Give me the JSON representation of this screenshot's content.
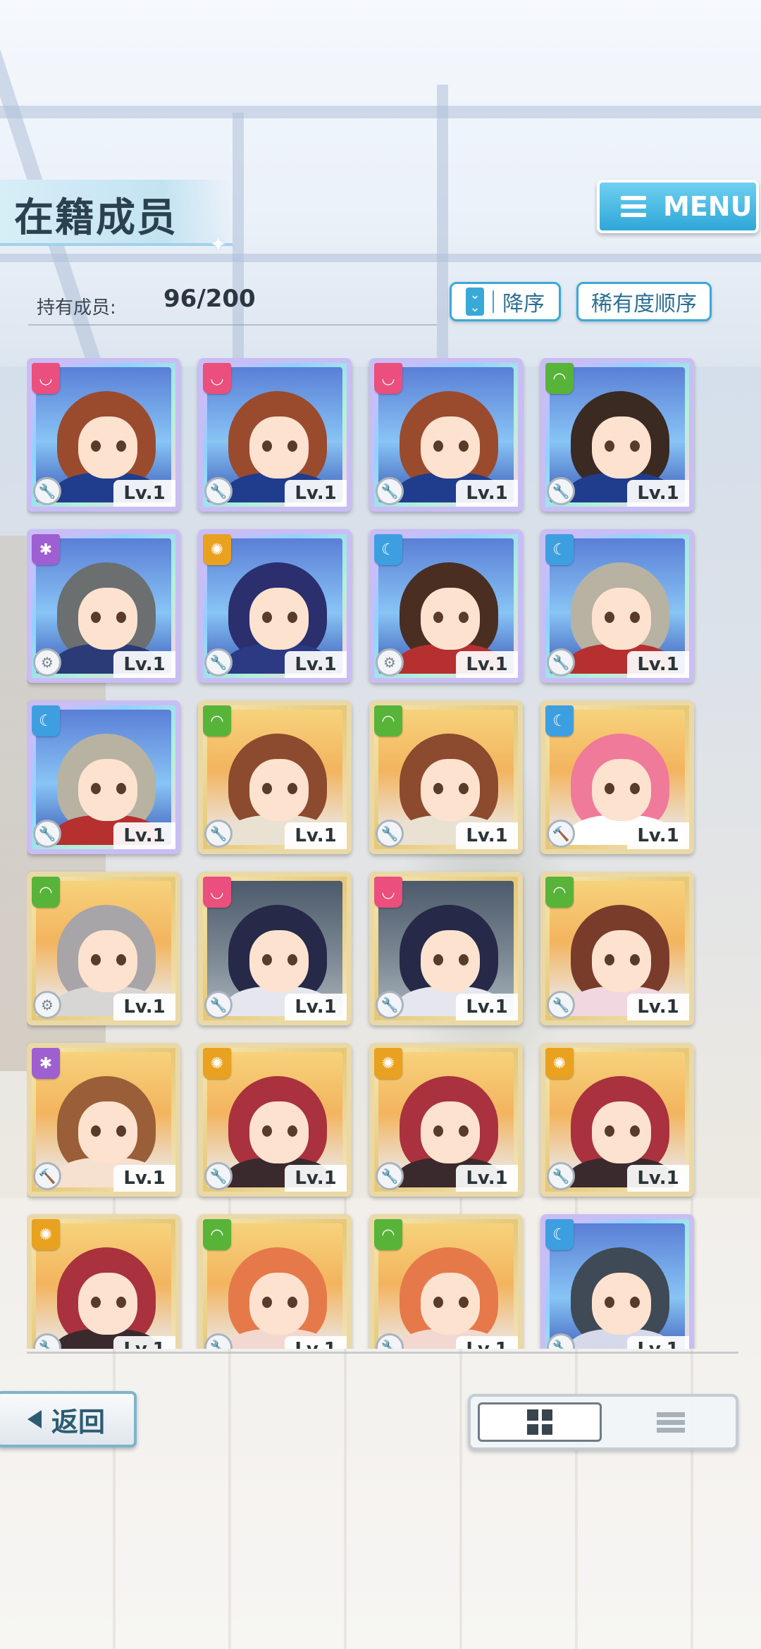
{
  "header": {
    "title": "在籍成员",
    "menu_label": "MENU"
  },
  "owned": {
    "label": "持有成员:",
    "value": "96/200"
  },
  "sort": {
    "order_label": "降序",
    "rarity_label": "稀有度顺序"
  },
  "level_text": "Lv.1",
  "cards": [
    {
      "frame": "ssr",
      "attr": "red",
      "hair": "#9a4b2e",
      "outfit": "#1f3d8c",
      "role": "wrench-icon",
      "art": "ssr"
    },
    {
      "frame": "ssr",
      "attr": "red",
      "hair": "#9a4b2e",
      "outfit": "#1f3d8c",
      "role": "wrench-icon",
      "art": "ssr"
    },
    {
      "frame": "ssr",
      "attr": "red",
      "hair": "#9a4b2e",
      "outfit": "#1f3d8c",
      "role": "wrench-icon",
      "art": "ssr"
    },
    {
      "frame": "ssr",
      "attr": "green",
      "hair": "#3a2a22",
      "outfit": "#1f3d8c",
      "role": "wrench-icon",
      "art": "ssr"
    },
    {
      "frame": "ssr",
      "attr": "purple",
      "hair": "#6b6f70",
      "outfit": "#2a3b78",
      "role": "gear-icon",
      "art": "ssr"
    },
    {
      "frame": "ssr",
      "attr": "orange",
      "hair": "#2b2f6e",
      "outfit": "#2b3a82",
      "role": "wrench-icon",
      "art": "ssr"
    },
    {
      "frame": "ssr",
      "attr": "blue",
      "hair": "#4a2e22",
      "outfit": "#b5302f",
      "role": "gear-icon",
      "art": "ssr"
    },
    {
      "frame": "ssr",
      "attr": "blue",
      "hair": "#b7b2a2",
      "outfit": "#b5302f",
      "role": "wrench-icon",
      "art": "ssr"
    },
    {
      "frame": "ssr",
      "attr": "blue",
      "hair": "#b7b2a2",
      "outfit": "#b5302f",
      "role": "wrench-icon",
      "art": "ssr"
    },
    {
      "frame": "sr",
      "attr": "green",
      "hair": "#8c4a2e",
      "outfit": "#e9e2d2",
      "role": "wrench-icon",
      "art": "sr"
    },
    {
      "frame": "sr",
      "attr": "green",
      "hair": "#8c4a2e",
      "outfit": "#e9e2d2",
      "role": "wrench-icon",
      "art": "sr"
    },
    {
      "frame": "sr",
      "attr": "blue",
      "hair": "#f07a9a",
      "outfit": "#ffffff",
      "role": "hammer-icon",
      "art": "sr"
    },
    {
      "frame": "sr",
      "attr": "green",
      "hair": "#a8a5a8",
      "outfit": "#d8d6d4",
      "role": "gear-icon",
      "art": "sr"
    },
    {
      "frame": "sr",
      "attr": "red",
      "hair": "#262947",
      "outfit": "#e6e6ee",
      "role": "wrench-icon",
      "art": "night"
    },
    {
      "frame": "sr",
      "attr": "red",
      "hair": "#262947",
      "outfit": "#e6e6ee",
      "role": "wrench-icon",
      "art": "night"
    },
    {
      "frame": "sr",
      "attr": "green",
      "hair": "#7a3c2a",
      "outfit": "#f0d7e0",
      "role": "wrench-icon",
      "art": "sr"
    },
    {
      "frame": "sr",
      "attr": "purple",
      "hair": "#9a5f38",
      "outfit": "#f6e0d0",
      "role": "hammer-icon",
      "art": "sr"
    },
    {
      "frame": "sr",
      "attr": "orange",
      "hair": "#a9323e",
      "outfit": "#3a2a2e",
      "role": "wrench-icon",
      "art": "sr"
    },
    {
      "frame": "sr",
      "attr": "orange",
      "hair": "#a9323e",
      "outfit": "#3a2a2e",
      "role": "wrench-icon",
      "art": "sr"
    },
    {
      "frame": "sr",
      "attr": "orange",
      "hair": "#a9323e",
      "outfit": "#3a2a2e",
      "role": "wrench-icon",
      "art": "sr"
    },
    {
      "frame": "sr",
      "attr": "orange",
      "hair": "#a9323e",
      "outfit": "#3a2a2e",
      "role": "wrench-icon",
      "art": "sr"
    },
    {
      "frame": "sr",
      "attr": "green",
      "hair": "#e6794a",
      "outfit": "#f2d8d0",
      "role": "wrench-icon",
      "art": "sr"
    },
    {
      "frame": "sr",
      "attr": "green",
      "hair": "#e6794a",
      "outfit": "#f2d8d0",
      "role": "wrench-icon",
      "art": "sr"
    },
    {
      "frame": "ssr",
      "attr": "blue",
      "hair": "#3f4a56",
      "outfit": "#d5d9ea",
      "role": "wrench-icon",
      "art": "ssr"
    }
  ],
  "footer": {
    "back_label": "返回",
    "view_mode_selected": "grid"
  }
}
